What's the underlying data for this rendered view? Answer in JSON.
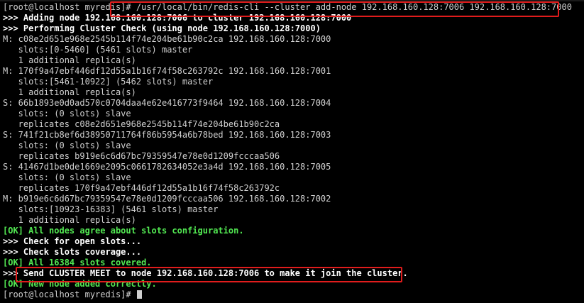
{
  "terminal": {
    "lines": [
      {
        "text": "[root@localhost myredis]# /usr/local/bin/redis-cli --cluster add-node 192.168.160.128:7006 192.168.160.128:7000",
        "style": "prompt"
      },
      {
        "text": ">>> Adding node 192.168.160.128:7006 to cluster 192.168.160.128:7000",
        "style": "bold"
      },
      {
        "text": ">>> Performing Cluster Check (using node 192.168.160.128:7000)",
        "style": "bold"
      },
      {
        "text": "M: c08e2d651e968e2545b114f74e204be61b90c2ca 192.168.160.128:7000",
        "style": "normal"
      },
      {
        "text": "   slots:[0-5460] (5461 slots) master",
        "style": "normal"
      },
      {
        "text": "   1 additional replica(s)",
        "style": "normal"
      },
      {
        "text": "M: 170f9a47ebf446df12d55a1b16f74f58c263792c 192.168.160.128:7001",
        "style": "normal"
      },
      {
        "text": "   slots:[5461-10922] (5462 slots) master",
        "style": "normal"
      },
      {
        "text": "   1 additional replica(s)",
        "style": "normal"
      },
      {
        "text": "S: 66b1893e0d0ad570c0704daa4e62e416773f9464 192.168.160.128:7004",
        "style": "normal"
      },
      {
        "text": "   slots: (0 slots) slave",
        "style": "normal"
      },
      {
        "text": "   replicates c08e2d651e968e2545b114f74e204be61b90c2ca",
        "style": "normal"
      },
      {
        "text": "S: 741f21cb8ef6d38950711764f86b5954a6b78bed 192.168.160.128:7003",
        "style": "normal"
      },
      {
        "text": "   slots: (0 slots) slave",
        "style": "normal"
      },
      {
        "text": "   replicates b919e6c6d67bc79359547e78e0d1209fcccaa506",
        "style": "normal"
      },
      {
        "text": "S: 41467d1be0de1669e2095c0661782634052e3a4d 192.168.160.128:7005",
        "style": "normal"
      },
      {
        "text": "   slots: (0 slots) slave",
        "style": "normal"
      },
      {
        "text": "   replicates 170f9a47ebf446df12d55a1b16f74f58c263792c",
        "style": "normal"
      },
      {
        "text": "M: b919e6c6d67bc79359547e78e0d1209fcccaa506 192.168.160.128:7002",
        "style": "normal"
      },
      {
        "text": "   slots:[10923-16383] (5461 slots) master",
        "style": "normal"
      },
      {
        "text": "   1 additional replica(s)",
        "style": "normal"
      },
      {
        "text": "[OK] All nodes agree about slots configuration.",
        "style": "green"
      },
      {
        "text": ">>> Check for open slots...",
        "style": "bold"
      },
      {
        "text": ">>> Check slots coverage...",
        "style": "bold"
      },
      {
        "text": "[OK] All 16384 slots covered.",
        "style": "green"
      },
      {
        "text": ">>> Send CLUSTER MEET to node 192.168.160.128:7006 to make it join the cluster.",
        "style": "bold"
      },
      {
        "text": "[OK] New node added correctly.",
        "style": "green"
      },
      {
        "text": "[root@localhost myredis]# ",
        "style": "prompt",
        "cursor": true
      }
    ],
    "colors": {
      "background": "#000000",
      "foreground": "#d0d0d0",
      "ok_green": "#52e852",
      "bold_white": "#ffffff",
      "highlight_red": "#e01c1c"
    }
  }
}
